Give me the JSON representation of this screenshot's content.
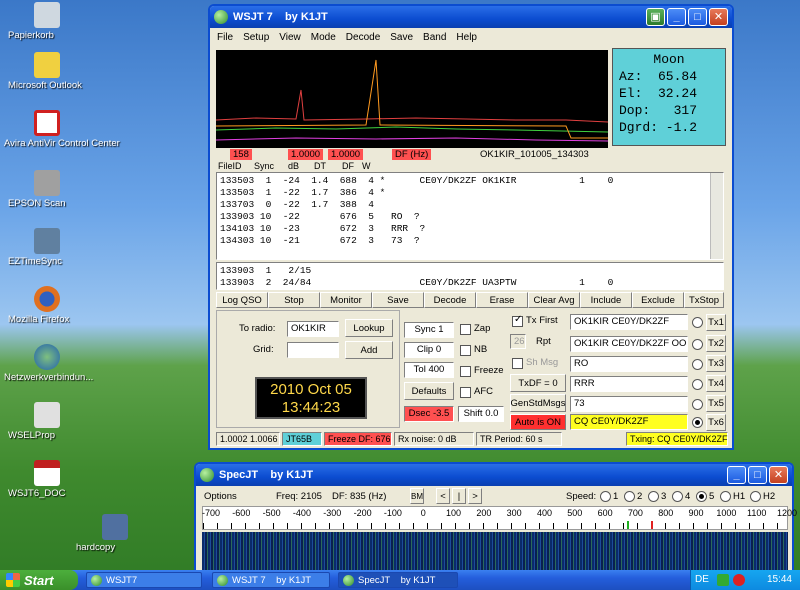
{
  "desktop": {
    "icons": [
      {
        "label": "Papierkorb",
        "color": "#cfd8e0"
      },
      {
        "label": "Microsoft Outlook",
        "color": "#f0d040"
      },
      {
        "label": "Avira AntiVir Control Center",
        "color": "#d02020"
      },
      {
        "label": "EPSON Scan",
        "color": "#a0a0a0"
      },
      {
        "label": "EZTimeSync",
        "color": "#6080a0"
      },
      {
        "label": "Mozilla Firefox",
        "color": "#e07020"
      },
      {
        "label": "Netzwerkverbindun...",
        "color": "#4080d0"
      },
      {
        "label": "WSELProp",
        "color": "#e0e0e0"
      },
      {
        "label": "WSJT6_DOC",
        "color": "#c02020"
      },
      {
        "label": "hardcopy",
        "color": "#5070a0"
      }
    ]
  },
  "wsjt": {
    "title": "WSJT 7    by K1JT",
    "menu": [
      "File",
      "Setup",
      "View",
      "Mode",
      "Decode",
      "Save",
      "Band",
      "Help"
    ],
    "moon": {
      "title": "Moon",
      "az": "Az:  65.84",
      "el": "El:  32.24",
      "dop": "Dop:   317",
      "dgrd": "Dgrd: -1.2"
    },
    "spectrum_labels": {
      "left": "158",
      "mid1": "1.0000",
      "mid2": "1.0000",
      "df": "DF (Hz)",
      "file": "OK1KIR_101005_134303"
    },
    "decode_header": [
      "FileID",
      "Sync",
      "dB",
      "DT",
      "DF",
      "W"
    ],
    "decodes": [
      "133503  1  -24  1.4  688  4 *      CE0Y/DK2ZF OK1KIR           1    0",
      "133503  1  -22  1.7  386  4 *",
      "133703  0  -22  1.7  388  4",
      "133903 10  -22       676  5   RO  ?",
      "134103 10  -23       672  3   RRR  ?",
      "134303 10  -21       672  3   73  ?"
    ],
    "avg_lines": [
      "133903  1   2/15",
      "133903  2  24/84                   CE0Y/DK2ZF UA3PTW           1    0"
    ],
    "buttons": [
      "Log QSO",
      "Stop",
      "Monitor",
      "Save",
      "Decode",
      "Erase",
      "Clear Avg",
      "Include",
      "Exclude",
      "TxStop"
    ],
    "to_radio_label": "To radio:",
    "to_radio_value": "OK1KIR",
    "lookup": "Lookup",
    "grid_label": "Grid:",
    "grid_value": "",
    "add": "Add",
    "date": "2010 Oct 05",
    "time": "13:44:23",
    "sync": "Sync  1",
    "clip": "Clip  0",
    "tol": "Tol  400",
    "defaults": "Defaults",
    "dsec": "Dsec  -3.5",
    "shift": "Shift 0.0",
    "checks": {
      "zap": "Zap",
      "nb": "NB",
      "freeze": "Freeze",
      "afc": "AFC"
    },
    "tx_first": "Tx First",
    "rpt_value": "26",
    "rpt": "Rpt",
    "sh_msg": "Sh Msg",
    "txdf": "TxDF = 0",
    "gen_std": "GenStdMsgs",
    "auto_on": "Auto is ON",
    "messages": [
      {
        "text": "OK1KIR CE0Y/DK2ZF",
        "tx": "Tx1"
      },
      {
        "text": "OK1KIR CE0Y/DK2ZF OOO",
        "tx": "Tx2"
      },
      {
        "text": "RO",
        "tx": "Tx3"
      },
      {
        "text": "RRR",
        "tx": "Tx4"
      },
      {
        "text": "73",
        "tx": "Tx5"
      },
      {
        "text": "CQ CE0Y/DK2ZF",
        "tx": "Tx6"
      }
    ],
    "status": {
      "ratio": "1.0002 1.0066",
      "mode": "JT65B",
      "freeze": "Freeze DF:  676",
      "rxnoise": "Rx noise:  0 dB",
      "trperiod": "TR Period: 60 s",
      "txing": "Txing:  CQ CE0Y/DK2ZF"
    }
  },
  "specjt": {
    "title": "SpecJT    by K1JT",
    "options": "Options",
    "freq": "Freq:  2105",
    "df": "DF:  835  (Hz)",
    "bm": "BM",
    "nav": [
      "<",
      "|",
      ">"
    ],
    "speed_label": "Speed:",
    "speeds": [
      "1",
      "2",
      "3",
      "4",
      "5",
      "H1",
      "H2"
    ],
    "speed_selected": "5",
    "scale": [
      "-700",
      "-600",
      "-500",
      "-400",
      "-300",
      "-200",
      "-100",
      "0",
      "100",
      "200",
      "300",
      "400",
      "500",
      "600",
      "700",
      "800",
      "900",
      "1000",
      "1100",
      "1200"
    ]
  },
  "taskbar": {
    "start": "Start",
    "tasks": [
      "WSJT7",
      "WSJT 7    by K1JT",
      "SpecJT    by K1JT"
    ],
    "lang": "DE",
    "clock": "15:44"
  }
}
